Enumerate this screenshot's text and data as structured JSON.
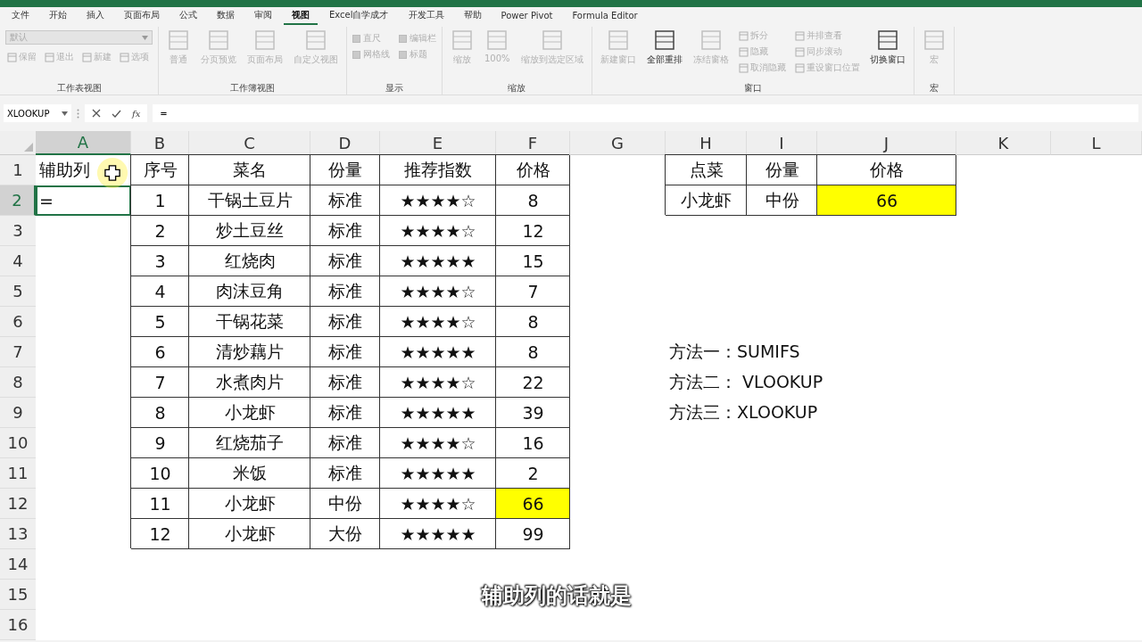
{
  "menu_tabs": [
    {
      "label": "文件",
      "selected": false
    },
    {
      "label": "开始",
      "selected": false
    },
    {
      "label": "插入",
      "selected": false
    },
    {
      "label": "页面布局",
      "selected": false
    },
    {
      "label": "公式",
      "selected": false
    },
    {
      "label": "数据",
      "selected": false
    },
    {
      "label": "审阅",
      "selected": false
    },
    {
      "label": "视图",
      "selected": true
    },
    {
      "label": "Excel自学成才",
      "selected": false
    },
    {
      "label": "开发工具",
      "selected": false
    },
    {
      "label": "帮助",
      "selected": false
    },
    {
      "label": "Power Pivot",
      "selected": false
    },
    {
      "label": "Formula Editor",
      "selected": false
    }
  ],
  "ribbon_groups": [
    {
      "label": "工作表视图",
      "items": [
        {
          "kind": "dropdown",
          "label": "默认",
          "disabled": true
        },
        {
          "kind": "small",
          "label": "保留",
          "disabled": true
        },
        {
          "kind": "small",
          "label": "退出",
          "disabled": true
        },
        {
          "kind": "small",
          "label": "新建",
          "disabled": true
        },
        {
          "kind": "small",
          "label": "选项",
          "disabled": true
        }
      ]
    },
    {
      "label": "工作簿视图",
      "items": [
        {
          "kind": "large",
          "label": "普通",
          "disabled": true
        },
        {
          "kind": "large",
          "label": "分页预览",
          "disabled": true
        },
        {
          "kind": "large",
          "label": "页面布局",
          "disabled": true
        },
        {
          "kind": "large",
          "label": "自定义视图",
          "disabled": true
        }
      ]
    },
    {
      "label": "显示",
      "items": [
        {
          "kind": "check",
          "label": "直尺",
          "disabled": true,
          "checked": true
        },
        {
          "kind": "check",
          "label": "编辑栏",
          "disabled": true,
          "checked": true
        },
        {
          "kind": "check",
          "label": "网格线",
          "disabled": true,
          "checked": true
        },
        {
          "kind": "check",
          "label": "标题",
          "disabled": true,
          "checked": true
        }
      ]
    },
    {
      "label": "缩放",
      "items": [
        {
          "kind": "large",
          "label": "缩放",
          "disabled": true
        },
        {
          "kind": "large",
          "label": "100%",
          "disabled": true
        },
        {
          "kind": "large",
          "label": "缩放到选定区域",
          "disabled": true
        }
      ]
    },
    {
      "label": "窗口",
      "items": [
        {
          "kind": "large",
          "label": "新建窗口",
          "disabled": true
        },
        {
          "kind": "large",
          "label": "全部重排",
          "disabled": false
        },
        {
          "kind": "large",
          "label": "冻结窗格",
          "disabled": true
        },
        {
          "kind": "small",
          "label": "拆分",
          "disabled": true
        },
        {
          "kind": "small",
          "label": "隐藏",
          "disabled": true
        },
        {
          "kind": "small",
          "label": "取消隐藏",
          "disabled": true
        },
        {
          "kind": "small",
          "label": "并排查看",
          "disabled": true
        },
        {
          "kind": "small",
          "label": "同步滚动",
          "disabled": true
        },
        {
          "kind": "small",
          "label": "重设窗口位置",
          "disabled": true
        },
        {
          "kind": "large",
          "label": "切换窗口",
          "disabled": false
        }
      ]
    },
    {
      "label": "宏",
      "items": [
        {
          "kind": "large",
          "label": "宏",
          "disabled": true
        }
      ]
    }
  ],
  "formula_bar": {
    "name_box": "XLOOKUP",
    "function_label": "fx",
    "value": "="
  },
  "columns": [
    {
      "label": "A",
      "selected": true
    },
    {
      "label": "B",
      "selected": false
    },
    {
      "label": "C",
      "selected": false
    },
    {
      "label": "D",
      "selected": false
    },
    {
      "label": "E",
      "selected": false
    },
    {
      "label": "F",
      "selected": false
    },
    {
      "label": "G",
      "selected": false
    },
    {
      "label": "H",
      "selected": false
    },
    {
      "label": "I",
      "selected": false
    },
    {
      "label": "J",
      "selected": false
    },
    {
      "label": "K",
      "selected": false
    },
    {
      "label": "L",
      "selected": false
    }
  ],
  "rows": [
    {
      "number": "1",
      "selected": false
    },
    {
      "number": "2",
      "selected": true
    },
    {
      "number": "3",
      "selected": false
    },
    {
      "number": "4",
      "selected": false
    },
    {
      "number": "5",
      "selected": false
    },
    {
      "number": "6",
      "selected": false
    },
    {
      "number": "7",
      "selected": false
    },
    {
      "number": "8",
      "selected": false
    },
    {
      "number": "9",
      "selected": false
    },
    {
      "number": "10",
      "selected": false
    },
    {
      "number": "11",
      "selected": false
    },
    {
      "number": "12",
      "selected": false
    },
    {
      "number": "13",
      "selected": false
    },
    {
      "number": "14",
      "selected": false
    },
    {
      "number": "15",
      "selected": false
    },
    {
      "number": "16",
      "selected": false
    }
  ],
  "helper_column": [
    {
      "text": "辅助列",
      "selected": false
    },
    {
      "text": "=",
      "selected": true
    }
  ],
  "menu_table": {
    "columns": [
      "序号",
      "菜名",
      "份量",
      "推荐指数",
      "价格"
    ],
    "rows": [
      {
        "cells": [
          "1",
          "干锅土豆片",
          "标准",
          "★★★★☆",
          "8"
        ],
        "highlight": false
      },
      {
        "cells": [
          "2",
          "炒土豆丝",
          "标准",
          "★★★★☆",
          "12"
        ],
        "highlight": false
      },
      {
        "cells": [
          "3",
          "红烧肉",
          "标准",
          "★★★★★",
          "15"
        ],
        "highlight": false
      },
      {
        "cells": [
          "4",
          "肉沫豆角",
          "标准",
          "★★★★☆",
          "7"
        ],
        "highlight": false
      },
      {
        "cells": [
          "5",
          "干锅花菜",
          "标准",
          "★★★★☆",
          "8"
        ],
        "highlight": false
      },
      {
        "cells": [
          "6",
          "清炒藕片",
          "标准",
          "★★★★★",
          "8"
        ],
        "highlight": false
      },
      {
        "cells": [
          "7",
          "水煮肉片",
          "标准",
          "★★★★☆",
          "22"
        ],
        "highlight": false
      },
      {
        "cells": [
          "8",
          "小龙虾",
          "标准",
          "★★★★★",
          "39"
        ],
        "highlight": false
      },
      {
        "cells": [
          "9",
          "红烧茄子",
          "标准",
          "★★★★☆",
          "16"
        ],
        "highlight": false
      },
      {
        "cells": [
          "10",
          "米饭",
          "标准",
          "★★★★★",
          "2"
        ],
        "highlight": false
      },
      {
        "cells": [
          "11",
          "小龙虾",
          "中份",
          "★★★★☆",
          "66"
        ],
        "highlight": true
      },
      {
        "cells": [
          "12",
          "小龙虾",
          "大份",
          "★★★★★",
          "99"
        ],
        "highlight": false
      }
    ]
  },
  "order_table": {
    "columns": [
      "点菜",
      "份量",
      "价格"
    ],
    "rows": [
      {
        "cells": [
          "小龙虾",
          "中份",
          "66"
        ],
        "highlight": true
      }
    ]
  },
  "notes": [
    "方法一：SUMIFS",
    "方法二： VLOOKUP",
    "方法三：XLOOKUP"
  ],
  "subtitle": "辅助列的话就是"
}
